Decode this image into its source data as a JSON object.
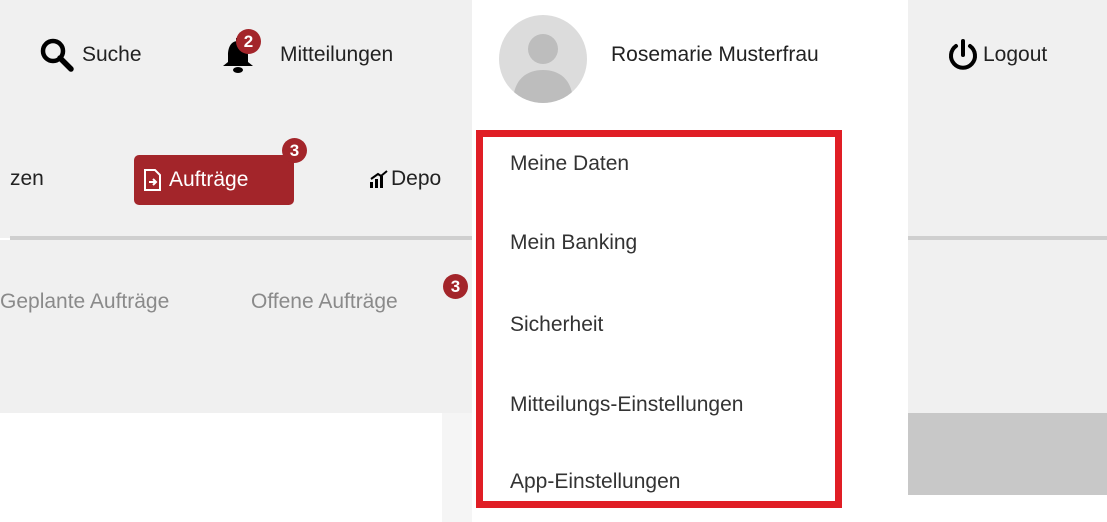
{
  "header": {
    "search_label": "Suche",
    "notifications_label": "Mitteilungen",
    "notifications_count": "2",
    "user_name": "Rosemarie Musterfrau",
    "logout_label": "Logout"
  },
  "nav": {
    "partial_label": "zen",
    "orders_label": "Aufträge",
    "orders_count": "3",
    "depot_label": "Depo"
  },
  "subnav": {
    "planned_label": "Geplante Aufträge",
    "open_label": "Offene Aufträge",
    "open_count": "3"
  },
  "user_menu": {
    "items": [
      {
        "label": "Meine Daten"
      },
      {
        "label": "Mein Banking"
      },
      {
        "label": "Sicherheit"
      },
      {
        "label": "Mitteilungs-Einstellungen"
      },
      {
        "label": "App-Einstellungen"
      }
    ]
  },
  "colors": {
    "accent": "#a3252a",
    "highlight_border": "#e01e25",
    "bar_background": "#f0f0f0"
  },
  "icons": {
    "search": "search-icon",
    "notifications": "bell-icon",
    "avatar": "user-avatar-icon",
    "logout": "power-icon",
    "orders": "document-arrow-icon",
    "depot": "bar-chart-icon"
  }
}
